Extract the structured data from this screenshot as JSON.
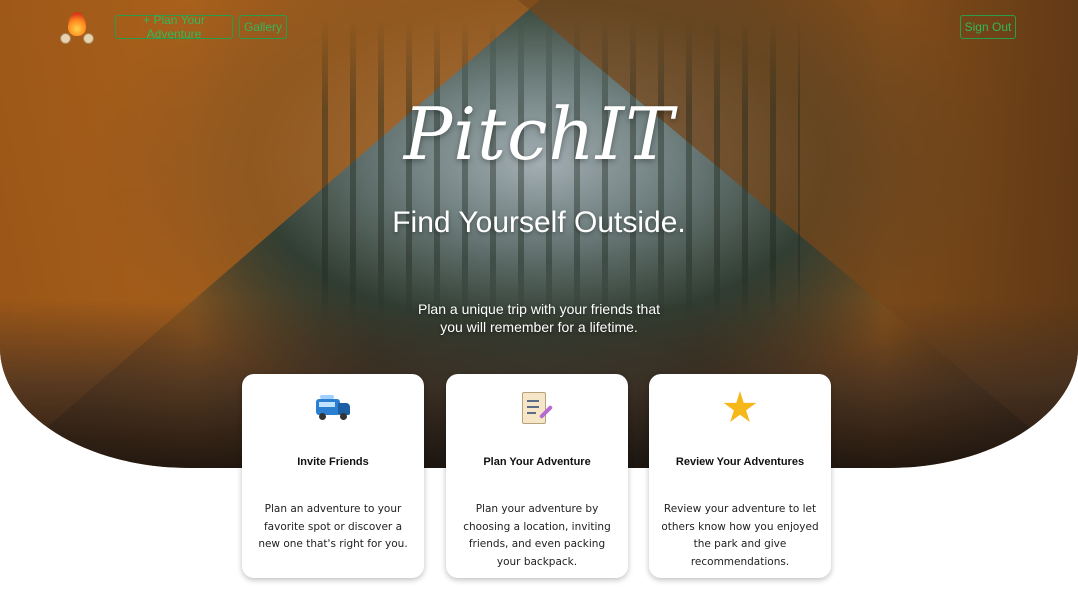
{
  "nav": {
    "plan_label": "+ Plan Your Adventure",
    "gallery_label": "Gallery",
    "signout_label": "Sign Out"
  },
  "hero": {
    "title": "PitchIT",
    "tagline": "Find Yourself Outside.",
    "subtitle": "Plan a unique trip with your friends that you will remember for a lifetime."
  },
  "cards": [
    {
      "icon": "camper-van-icon",
      "title": "Invite Friends",
      "text": "Plan an adventure to your favorite spot or discover a new one that's right for you."
    },
    {
      "icon": "clipboard-checklist-icon",
      "title": "Plan Your Adventure",
      "text": "Plan your adventure by choosing a location, inviting friends, and even packing your backpack."
    },
    {
      "icon": "star-icon",
      "title": "Review Your Adventures",
      "text": "Review your adventure to let others know how you enjoyed the park and give recommendations."
    }
  ],
  "colors": {
    "accent_green": "#34b85a",
    "card_bg": "#ffffff"
  }
}
